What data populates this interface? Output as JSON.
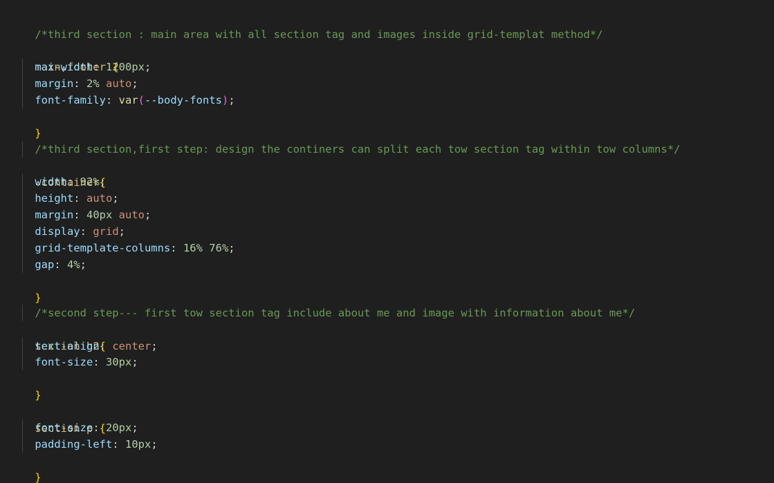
{
  "editor": {
    "comments": {
      "c1": "/*third section : main area with all section tag and images inside grid-templat method*/",
      "c2": "/*third section,first step: design the continers can split each tow section tag within tow columns*/",
      "c3": "/*second step--- first tow section tag include about me and image with information about me*/"
    },
    "rule1": {
      "selector": "main,footer",
      "open": "{",
      "close": "}",
      "d1": {
        "prop": "max-width",
        "val": "1200px"
      },
      "d2": {
        "prop": "margin",
        "val1": "2%",
        "val2": "auto"
      },
      "d3": {
        "prop": "font-family",
        "fn": "var",
        "arg": "--body-fonts"
      }
    },
    "rule2": {
      "selector": ".container",
      "open": "{",
      "close": "}",
      "d1": {
        "prop": "width",
        "val": "92%"
      },
      "d2": {
        "prop": "height",
        "val": "auto"
      },
      "d3": {
        "prop": "margin",
        "val1": "40px",
        "val2": "auto"
      },
      "d4": {
        "prop": "display",
        "val": "grid"
      },
      "d5": {
        "prop": "grid-template-columns",
        "val": "16% 76%"
      },
      "d6": {
        "prop": "gap",
        "val": "4%"
      }
    },
    "rule3": {
      "selector": "section h2",
      "open": "{",
      "close": "}",
      "d1": {
        "prop": "text-align",
        "val": "center"
      },
      "d2": {
        "prop": "font-size",
        "val": "30px"
      }
    },
    "rule4": {
      "selector": "section p",
      "open": "{",
      "close": "}",
      "d1": {
        "prop": "font-size",
        "val": "20px"
      },
      "d2": {
        "prop": "padding-left",
        "val": "10px"
      }
    }
  }
}
